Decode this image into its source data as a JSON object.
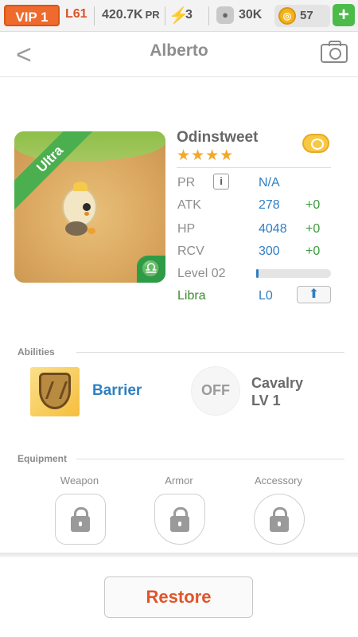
{
  "topbar": {
    "vip": "VIP 1",
    "level": "L61",
    "power": "420.7K",
    "power_unit": "PR",
    "energy": "3",
    "paw": "30K",
    "coins": "57",
    "add_label": "+"
  },
  "header": {
    "back_label": "<",
    "title": "Alberto"
  },
  "pet": {
    "rarity": "Ultra",
    "name": "Odinstweet",
    "stars": "★★★★",
    "zodiac_symbol": "♎",
    "stats": {
      "pr_label": "PR",
      "pr_value": "N/A",
      "info_label": "i",
      "atk_label": "ATK",
      "atk_value": "278",
      "atk_bonus": "+0",
      "hp_label": "HP",
      "hp_value": "4048",
      "hp_bonus": "+0",
      "rcv_label": "RCV",
      "rcv_value": "300",
      "rcv_bonus": "+0",
      "level_label": "Level 02",
      "level_progress": 0.03,
      "zodiac_label": "Libra",
      "zodiac_level": "L0",
      "upgrade_icon": "⬆"
    }
  },
  "abilities": {
    "section_title": "Abilities",
    "primary_name": "Barrier",
    "secondary_state": "OFF",
    "secondary_name": "Cavalry",
    "secondary_level": "LV 1"
  },
  "equipment": {
    "section_title": "Equipment",
    "slots": [
      {
        "label": "Weapon"
      },
      {
        "label": "Armor"
      },
      {
        "label": "Accessory"
      }
    ]
  },
  "footer": {
    "restore_label": "Restore"
  },
  "colors": {
    "accent_orange": "#ef6a2d",
    "stat_blue": "#2f7fc2",
    "bonus_green": "#3d9b3d",
    "rarity_green": "#4bae4f",
    "restore_red": "#e0552a"
  }
}
